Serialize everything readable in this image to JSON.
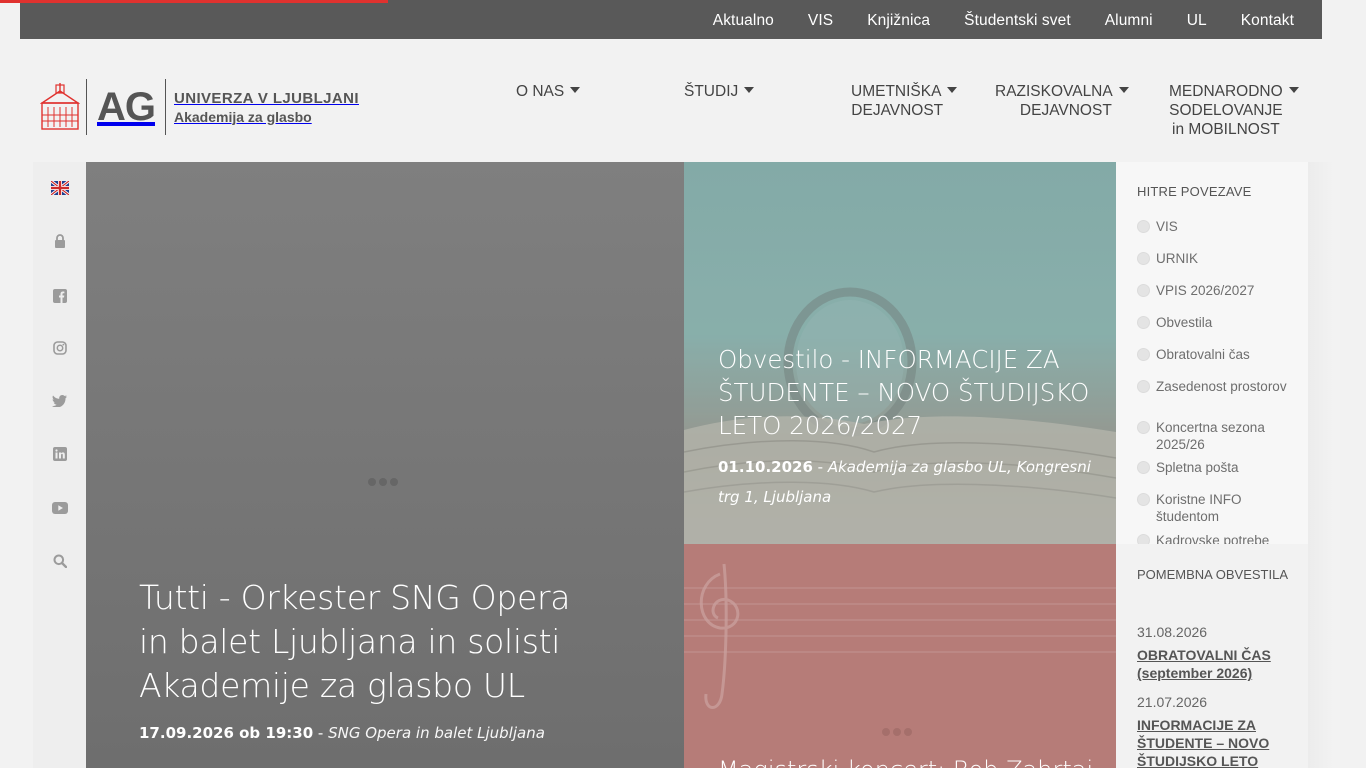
{
  "top_nav": {
    "items": [
      "Aktualno",
      "VIS",
      "Knjižnica",
      "Študentski svet",
      "Alumni",
      "UL",
      "Kontakt"
    ]
  },
  "logo": {
    "abbr": "AG",
    "line1": "UNIVERZA V LJUBLJANI",
    "line2": "Akademija za glasbo"
  },
  "main_nav": {
    "o_nas": "O NAS",
    "studij": "ŠTUDIJ",
    "umetniska_1": "UMETNIŠKA",
    "umetniska_2": "DEJAVNOST",
    "raziskovalna_1": "RAZISKOVALNA",
    "raziskovalna_2": "DEJAVNOST",
    "mednarodno_1": "MEDNARODNO",
    "mednarodno_2": "SODELOVANJE",
    "mednarodno_3": "in MOBILNOST"
  },
  "sidebar_icons": [
    "uk-flag-icon",
    "lock-icon",
    "facebook-icon",
    "instagram-icon",
    "twitter-icon",
    "linkedin-icon",
    "youtube-icon",
    "search-icon"
  ],
  "hero": {
    "title": "Tutti - Orkester SNG Opera in balet Ljubljana in solisti Akademije za glasbo UL",
    "date": "17.09.2026 ob 19:30",
    "sep": " - ",
    "location": "SNG Opera in balet Ljubljana"
  },
  "panel_top": {
    "title": "Obvestilo - INFORMACIJE ZA ŠTUDENTE – NOVO ŠTUDIJSKO LETO 2026/2027",
    "date": "01.10.2026",
    "sep": " - ",
    "location": "Akademija za glasbo UL, Kongresni trg 1, Ljubljana"
  },
  "panel_bottom": {
    "title": "Magistrski koncert: Bob Zahrtai"
  },
  "quick_links": {
    "heading": "HITRE POVEZAVE",
    "items": [
      "VIS",
      "URNIK",
      "VPIS 2026/2027",
      "Obvestila",
      "Obratovalni čas",
      "Zasedenost prostorov",
      "Koncertna sezona 2025/26",
      "Spletna pošta",
      "Koristne INFO študentom",
      "Kadrovske potrebe"
    ]
  },
  "news": {
    "heading": "POMEMBNA OBVESTILA",
    "items": [
      {
        "date": "31.08.2026",
        "title": "OBRATOVALNI ČAS (september 2026)"
      },
      {
        "date": "21.07.2026",
        "title": "INFORMACIJE ZA ŠTUDENTE – NOVO ŠTUDIJSKO LETO"
      }
    ]
  },
  "colors": {
    "topbar": "#595959",
    "accent_red": "#e0322f",
    "panel_red": "#b67c78",
    "panel_teal": "#8fb6b2"
  }
}
